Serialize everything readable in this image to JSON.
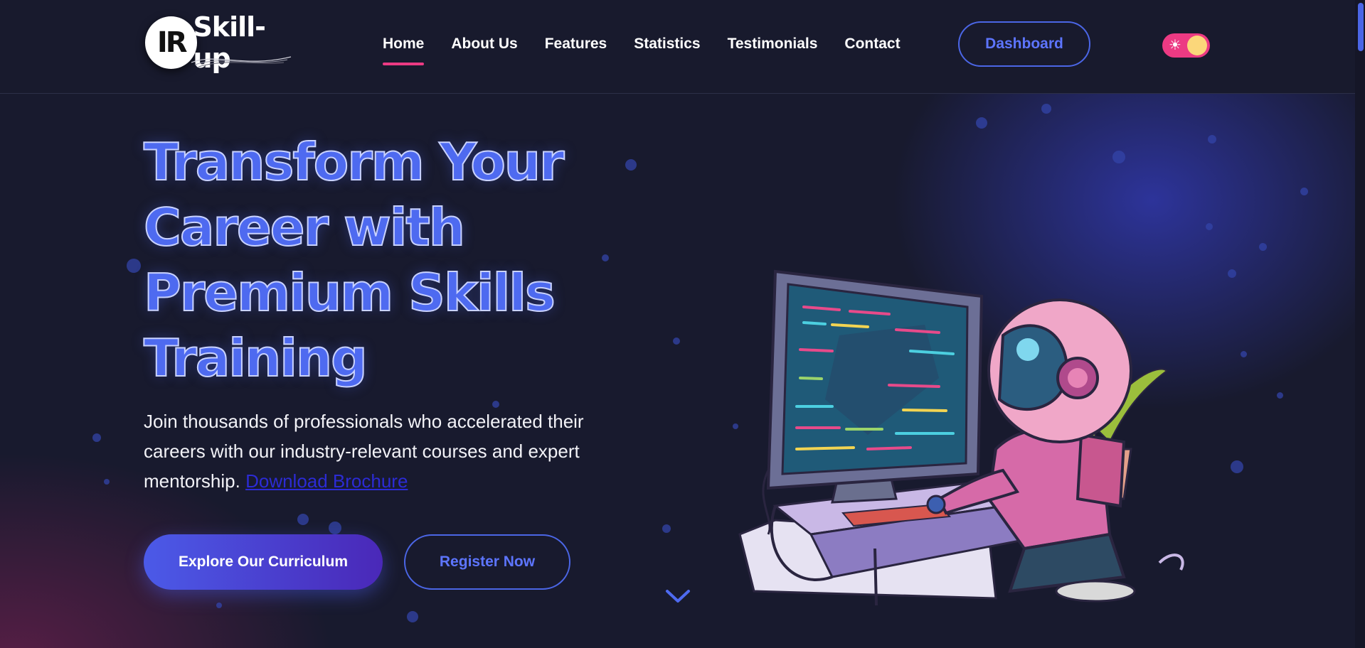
{
  "header": {
    "logo_mark": "IR",
    "logo_text": "Skill-up",
    "nav": [
      {
        "label": "Home",
        "active": true
      },
      {
        "label": "About Us",
        "active": false
      },
      {
        "label": "Features",
        "active": false
      },
      {
        "label": "Statistics",
        "active": false
      },
      {
        "label": "Testimonials",
        "active": false
      },
      {
        "label": "Contact",
        "active": false
      }
    ],
    "dashboard_label": "Dashboard",
    "theme_toggle_icon": "sun-icon"
  },
  "hero": {
    "title_lines": [
      "Transform Your",
      "Career with",
      "Premium Skills",
      "Training"
    ],
    "description": "Join thousands of professionals who accelerated their careers with our industry-relevant courses and expert mentorship.",
    "brochure_link": "Download Brochure",
    "primary_button": "Explore Our Curriculum",
    "secondary_button": "Register Now",
    "scroll_icon": "chevron-down-icon",
    "illustration": "astronaut-coding-at-computer-illustration"
  },
  "colors": {
    "background": "#181a2e",
    "accent_blue": "#4b66e6",
    "accent_pink": "#ec3a83",
    "link": "#2c2bd4",
    "toggle_knob": "#fbd77a"
  }
}
